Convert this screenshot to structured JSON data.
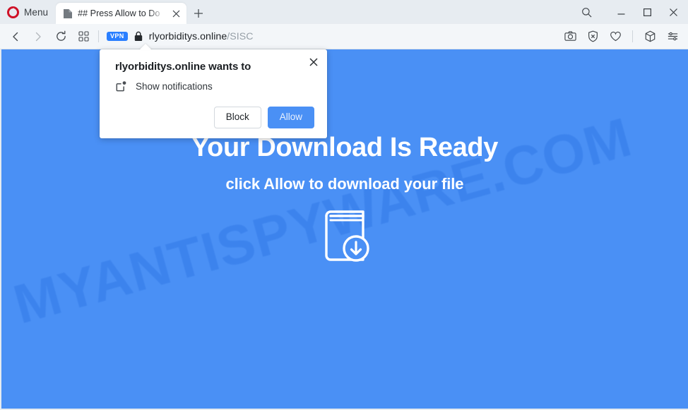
{
  "browser": {
    "menu_label": "Menu",
    "tab": {
      "title": "## Press Allow to Do",
      "favicon_icon": "page-icon",
      "close_icon": "close-icon"
    },
    "new_tab_icon": "plus-icon",
    "window_controls": {
      "search_icon": "search-icon",
      "minimize_icon": "minimize-icon",
      "maximize_icon": "maximize-icon",
      "close_icon": "close-icon"
    },
    "toolbar": {
      "back_icon": "chevron-left-icon",
      "forward_icon": "chevron-right-icon",
      "reload_icon": "reload-icon",
      "speeddial_icon": "grid-icon",
      "vpn_badge": "VPN",
      "lock_icon": "lock-icon",
      "url_host": "rlyorbiditys.online",
      "url_path": "/SISC",
      "right_icons": [
        "camera-icon",
        "shield-block-icon",
        "heart-icon",
        "cube-icon",
        "sliders-icon"
      ]
    }
  },
  "page": {
    "background_color": "#4a90f5",
    "watermark": "MYANTISPYWARE.COM",
    "hero_title": "Your Download Is Ready",
    "hero_subtitle": "click Allow to download your file",
    "hero_icon": "book-download-icon"
  },
  "permission_dialog": {
    "title": "rlyorbiditys.online wants to",
    "permission_icon": "notification-icon",
    "permission_text": "Show notifications",
    "block_label": "Block",
    "allow_label": "Allow",
    "close_icon": "close-icon",
    "allow_color": "#4a90f5"
  }
}
